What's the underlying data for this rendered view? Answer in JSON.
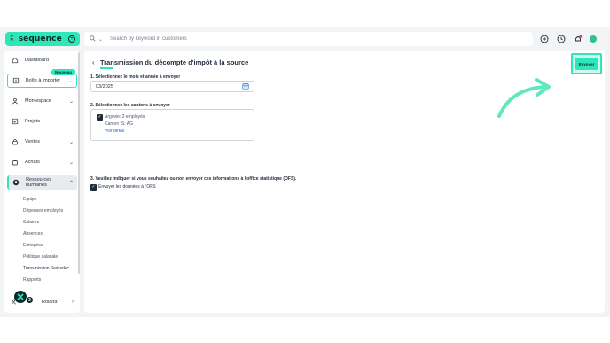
{
  "brand": {
    "name": "sequence",
    "mark": "⁑"
  },
  "search": {
    "placeholder": "Search by keyword in customers"
  },
  "user": {
    "initial": "",
    "name": "Roland"
  },
  "colors": {
    "accent": "#2ee6b8",
    "dark": "#0b2a2a",
    "link": "#1c6ad6",
    "notification": "#e5484d"
  },
  "sidebar": {
    "items": [
      {
        "label": "Dashboard",
        "icon": "home-icon"
      },
      {
        "label": "Boîte à importer",
        "icon": "inbox-icon",
        "badge": "Nouveau"
      },
      {
        "label": "Mon espace",
        "icon": "user-icon"
      },
      {
        "label": "Projets",
        "icon": "checkbox-icon"
      },
      {
        "label": "Ventes",
        "icon": "lock-icon"
      },
      {
        "label": "Achats",
        "icon": "bag-icon"
      },
      {
        "label": "Ressources humaines",
        "icon": "hr-icon"
      }
    ],
    "subitems": [
      "Equipe",
      "Dépenses employés",
      "Salaires",
      "Absences",
      "Entreprise",
      "Politique salariale",
      "Transmission Swissdec",
      "Rapports"
    ],
    "floating_count": "3"
  },
  "page": {
    "title": "Transmission du décompte d'impôt à la source",
    "send_label": "Envoyer",
    "step1": "1. Sélectionnez le mois et année à envoyer",
    "date_value": "03/2025",
    "step2": "2. Sélectionnez les cantons à envoyer",
    "canton_name": "Argovie: 2 employés",
    "canton_sub": "Canton IS: AG",
    "canton_link": "Voir détail",
    "step3": "3. Veuillez indiquer si vous souhaitez ou non envoyer ces informations à l'office statistique (OFS).",
    "ofs_label": "Envoyer les données à l'OFS"
  }
}
